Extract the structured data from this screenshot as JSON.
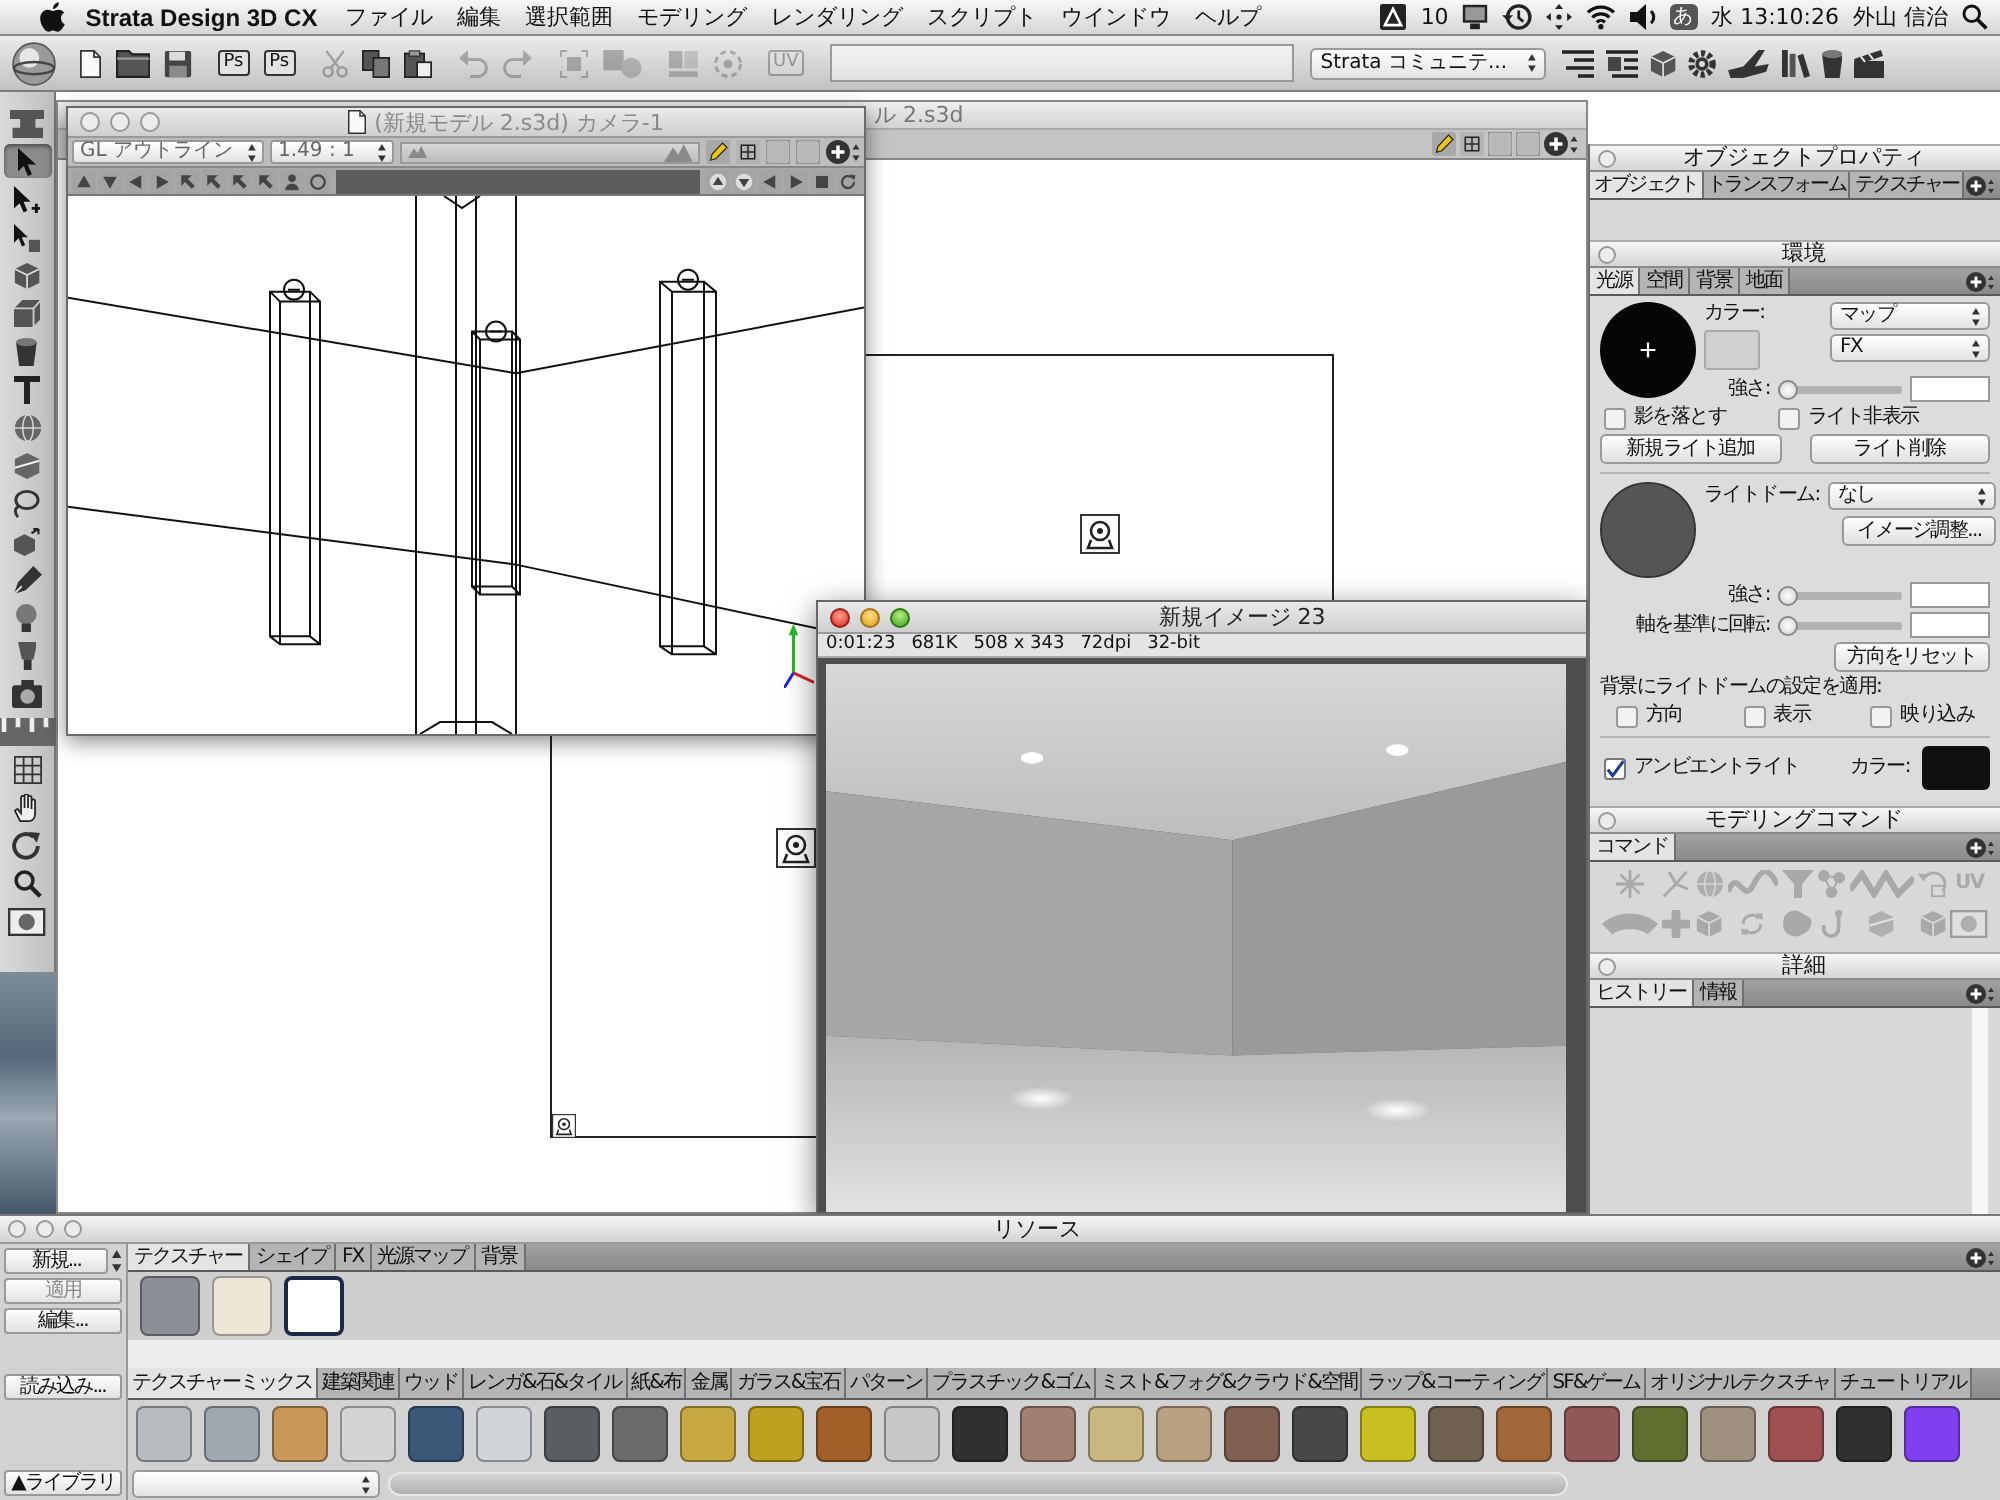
{
  "menu_bar": {
    "app_name": "Strata Design 3D CX",
    "menus": [
      "ファイル",
      "編集",
      "選択範囲",
      "モデリング",
      "レンダリング",
      "スクリプト",
      "ウインドウ",
      "ヘルプ"
    ],
    "status": {
      "badge_count": "10",
      "input_mode": "あ",
      "clock": "水 13:10:26",
      "user": "外山 信治"
    }
  },
  "toolbar": {
    "groups": [
      [
        {
          "kind": "icon",
          "disabled": false
        },
        {
          "kind": "icon",
          "disabled": false
        },
        {
          "kind": "icon",
          "disabled": false
        }
      ],
      [
        {
          "kind": "text",
          "label": "Ps",
          "disabled": false
        },
        {
          "kind": "text",
          "label": "Ps",
          "disabled": false
        }
      ],
      [
        {
          "kind": "icon",
          "disabled": true
        },
        {
          "kind": "icon",
          "disabled": false
        },
        {
          "kind": "icon",
          "disabled": false
        }
      ],
      [
        {
          "kind": "icon",
          "disabled": true
        },
        {
          "kind": "icon",
          "disabled": true
        }
      ],
      [
        {
          "kind": "icon",
          "disabled": true
        },
        {
          "kind": "icon",
          "disabled": true
        }
      ],
      [
        {
          "kind": "icon",
          "disabled": true
        },
        {
          "kind": "icon",
          "disabled": true
        }
      ],
      [
        {
          "kind": "text",
          "label": "UV",
          "disabled": true
        }
      ]
    ],
    "community_select": "Strata コミュニテ..."
  },
  "tool_palette": {
    "tools": [
      {
        "selected": false
      },
      {
        "selected": true
      },
      {
        "selected": false
      },
      {
        "selected": false
      },
      {
        "selected": false
      },
      {
        "selected": false
      },
      {
        "selected": false
      },
      {
        "selected": false
      },
      {
        "selected": false
      },
      {
        "selected": false
      },
      {
        "selected": false
      },
      {
        "selected": false
      },
      {
        "selected": false
      },
      {
        "selected": false
      },
      {
        "selected": false
      },
      {
        "selected": false
      },
      {
        "selected": false
      },
      {
        "selected": false
      },
      {
        "selected": false
      },
      {
        "selected": false
      },
      {
        "selected": false
      },
      {
        "selected": false
      }
    ]
  },
  "model_window": {
    "title": "ル 2.s3d"
  },
  "camera_window": {
    "title": "(新規モデル 2.s3d) カメラ-1",
    "active": false,
    "render_mode": "GL アウトライン",
    "zoom": "1.49 : 1"
  },
  "render_window": {
    "title": "新規イメージ 23",
    "active": true,
    "info": [
      "0:01:23",
      "681K",
      "508 x 343",
      "72dpi",
      "32-bit"
    ]
  },
  "object_properties": {
    "title": "オブジェクトプロパティ",
    "tabs": [
      {
        "label": "オブジェクト",
        "selected": true
      },
      {
        "label": "トランスフォーム",
        "selected": false
      },
      {
        "label": "テクスチャー",
        "selected": false
      }
    ]
  },
  "environment": {
    "title": "環境",
    "tabs": [
      {
        "label": "光源",
        "selected": true
      },
      {
        "label": "空間",
        "selected": false
      },
      {
        "label": "背景",
        "selected": false
      },
      {
        "label": "地面",
        "selected": false
      }
    ],
    "color_label": "カラー:",
    "map_select": "マップ",
    "fx_select": "FX",
    "strength_label": "強さ:",
    "strength": {
      "level": 0
    },
    "cast_shadow": {
      "label": "影を落とす",
      "checked": false
    },
    "hide_light": {
      "label": "ライト非表示",
      "checked": false
    },
    "add_light_button": "新規ライト追加",
    "delete_light_button": "ライト削除",
    "light_dome_label": "ライトドーム:",
    "light_dome_select": "なし",
    "image_adjust_button": "イメージ調整...",
    "dome_strength_label": "強さ:",
    "dome_strength": {
      "level": 0
    },
    "rotate_label": "軸を基準に回転:",
    "rotate": {
      "level": 0
    },
    "reset_button": "方向をリセット",
    "apply_label": "背景にライトドームの設定を適用:",
    "apply_options": [
      {
        "label": "方向",
        "checked": false
      },
      {
        "label": "表示",
        "checked": false
      },
      {
        "label": "映り込み",
        "checked": false
      }
    ],
    "ambient": {
      "label": "アンビエントライト",
      "checked": true
    },
    "ambient_color_label": "カラー:"
  },
  "modeling_commands": {
    "title": "モデリングコマンド",
    "tabs": [
      {
        "label": "コマンド",
        "selected": true
      }
    ],
    "commands": [
      {
        "kind": "icon",
        "disabled": true
      },
      {
        "kind": "icon",
        "disabled": true
      },
      {
        "kind": "icon",
        "disabled": true
      },
      {
        "kind": "icon",
        "disabled": true
      },
      {
        "kind": "icon",
        "disabled": true
      },
      {
        "kind": "icon",
        "disabled": true
      },
      {
        "kind": "icon",
        "disabled": true
      },
      {
        "kind": "icon",
        "disabled": true
      },
      {
        "kind": "text",
        "label": "UV",
        "disabled": true
      },
      {
        "kind": "icon",
        "disabled": true
      },
      {
        "kind": "icon",
        "disabled": true
      },
      {
        "kind": "icon",
        "disabled": true
      },
      {
        "kind": "icon",
        "disabled": true
      },
      {
        "kind": "icon",
        "disabled": true
      },
      {
        "kind": "icon",
        "disabled": true
      },
      {
        "kind": "icon",
        "disabled": true
      },
      {
        "kind": "icon",
        "disabled": true
      },
      {
        "kind": "icon",
        "disabled": true
      }
    ]
  },
  "details": {
    "title": "詳細",
    "tabs": [
      {
        "label": "ヒストリー",
        "selected": true
      },
      {
        "label": "情報",
        "selected": false
      }
    ]
  },
  "resources": {
    "title": "リソース",
    "side_buttons": [
      {
        "label": "新規...",
        "disabled": false
      },
      {
        "label": "適用",
        "disabled": true
      },
      {
        "label": "編集...",
        "disabled": false
      }
    ],
    "import_button": "読み込み...",
    "library_button": "▲ライブラリ",
    "tabs": [
      {
        "label": "テクスチャー",
        "selected": true
      },
      {
        "label": "シェイプ",
        "selected": false
      },
      {
        "label": "FX",
        "selected": false
      },
      {
        "label": "光源マップ",
        "selected": false
      },
      {
        "label": "背景",
        "selected": false
      }
    ],
    "swatches": [
      {
        "color": "#8c9096",
        "selected": false
      },
      {
        "color": "#ece6d6",
        "selected": false
      },
      {
        "color": "#ffffff",
        "selected": true
      }
    ],
    "library_tabs": [
      {
        "label": "テクスチャーミックス",
        "selected": true
      },
      {
        "label": "建築関連",
        "selected": false
      },
      {
        "label": "ウッド",
        "selected": false
      },
      {
        "label": "レンガ&石&タイル",
        "selected": false
      },
      {
        "label": "紙&布",
        "selected": false
      },
      {
        "label": "金属",
        "selected": false
      },
      {
        "label": "ガラス&宝石",
        "selected": false
      },
      {
        "label": "パターン",
        "selected": false
      },
      {
        "label": "プラスチック&ゴム",
        "selected": false
      },
      {
        "label": "ミスト&フォグ&クラウド&空間",
        "selected": false
      },
      {
        "label": "ラップ&コーティング",
        "selected": false
      },
      {
        "label": "SF&ゲーム",
        "selected": false
      },
      {
        "label": "オリジナルテクスチャ",
        "selected": false
      },
      {
        "label": "チュートリアル",
        "selected": false
      }
    ],
    "library_swatches": [
      {
        "color": "#b8bcc0"
      },
      {
        "color": "#a0a8b0"
      },
      {
        "color": "#c89858"
      },
      {
        "color": "#d4d4d4"
      },
      {
        "color": "#3a5878"
      },
      {
        "color": "#d0d4d8"
      },
      {
        "color": "#5a5e62"
      },
      {
        "color": "#6a6a6a"
      },
      {
        "color": "#c8a840"
      },
      {
        "color": "#c0a020"
      },
      {
        "color": "#a06028"
      },
      {
        "color": "#c8c8c8"
      },
      {
        "color": "#303030"
      },
      {
        "color": "#a08070"
      },
      {
        "color": "#c8b880"
      },
      {
        "color": "#b8a080"
      },
      {
        "color": "#806050"
      },
      {
        "color": "#484848"
      },
      {
        "color": "#c8c020"
      },
      {
        "color": "#706050"
      },
      {
        "color": "#a06838"
      },
      {
        "color": "#905858"
      },
      {
        "color": "#607030"
      },
      {
        "color": "#a09080"
      },
      {
        "color": "#a05050"
      },
      {
        "color": "#303030"
      },
      {
        "color": "#8040f0"
      }
    ]
  }
}
